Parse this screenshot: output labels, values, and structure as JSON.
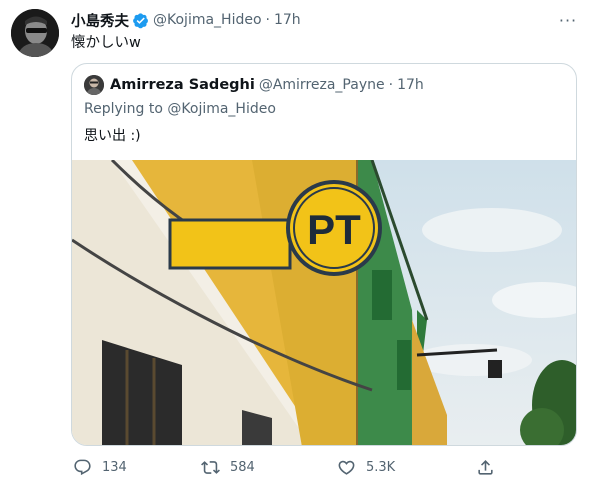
{
  "tweet": {
    "author_name": "小島秀夫",
    "author_handle": "@Kojima_Hideo",
    "separator": "·",
    "time": "17h",
    "text": "懐かしいw",
    "more_label": "···",
    "avatar_icon": "user-avatar"
  },
  "quote": {
    "author_name": "Amirreza Sadeghi",
    "author_handle": "@Amirreza_Payne",
    "separator": "·",
    "time": "17h",
    "replying_prefix": "Replying to",
    "replying_mention": "@Kojima_Hideo",
    "text": "思い出 :)",
    "image_sign_text": "PT"
  },
  "actions": {
    "reply_count": "134",
    "retweet_count": "584",
    "like_count": "5.3K"
  },
  "colors": {
    "text_primary": "#0f1419",
    "text_secondary": "#536471",
    "verified_blue": "#1d9bf0",
    "border": "#cfd9de",
    "sign_yellow": "#f2c318",
    "wall_yellow": "#e6b63b",
    "wall_green": "#3d8a4a"
  }
}
